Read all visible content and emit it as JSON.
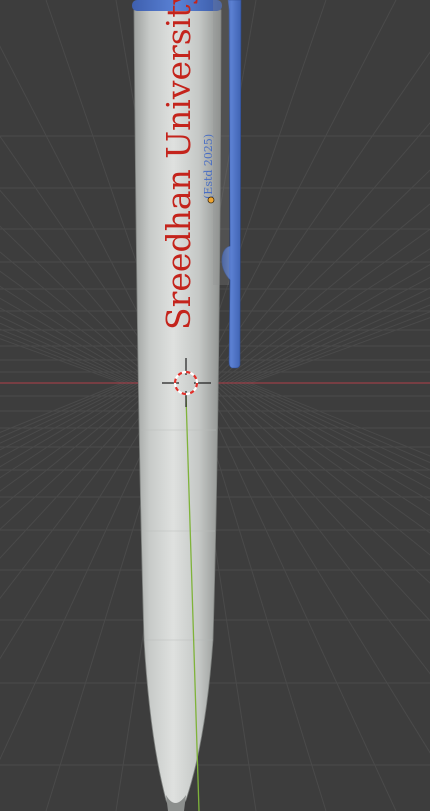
{
  "viewport": {
    "background": "#3d3d3d",
    "grid_color": "#4a4a4a",
    "x_axis_color": "#9a3f47",
    "y_axis_color": "#7fb33a"
  },
  "pen": {
    "barrel_color": "#c9ccc9",
    "clip_color": "#4a6fc4",
    "engraving": {
      "title": "Sreedhan University",
      "title_color": "#c4241c",
      "subtitle": "(Estd 2025)",
      "subtitle_color": "#4a6fc4"
    }
  },
  "icons": {
    "cursor": "3d-cursor-icon",
    "origin": "object-origin-icon"
  }
}
